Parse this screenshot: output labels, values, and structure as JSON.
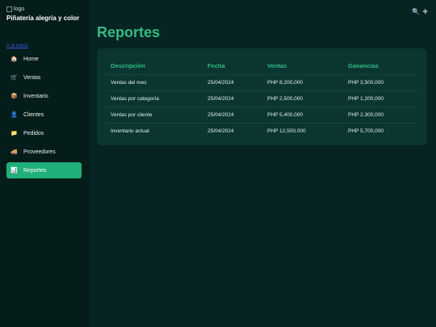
{
  "app": {
    "logo_alt": "logo",
    "brand": "Piñatería alegría y color",
    "menu_link": "Ir al menú"
  },
  "sidebar": {
    "items": [
      {
        "label": "Home",
        "icon": "🏠",
        "icon_name": "home-icon",
        "active": false
      },
      {
        "label": "Ventas",
        "icon": "🛒",
        "icon_name": "cart-icon",
        "active": false
      },
      {
        "label": "Inventario",
        "icon": "📦",
        "icon_name": "box-icon",
        "active": false
      },
      {
        "label": "Clientes",
        "icon": "👤",
        "icon_name": "user-icon",
        "active": false
      },
      {
        "label": "Pedidos",
        "icon": "📁",
        "icon_name": "folder-icon",
        "active": false
      },
      {
        "label": "Proveedores",
        "icon": "🚚",
        "icon_name": "truck-icon",
        "active": false
      },
      {
        "label": "Reportes",
        "icon": "📊",
        "icon_name": "chart-icon",
        "active": true
      }
    ]
  },
  "header": {
    "title": "Reportes",
    "icons": [
      {
        "glyph": "🔍",
        "name": "search-icon"
      },
      {
        "glyph": "✚",
        "name": "add-icon"
      }
    ]
  },
  "table": {
    "columns": [
      "Descripción",
      "Fecha",
      "Ventas",
      "Ganancias"
    ],
    "rows": [
      [
        "Ventas del mes",
        "25/04/2024",
        "PHP 8,200,000",
        "PHP 3,500,000"
      ],
      [
        "Ventas por categoría",
        "25/04/2024",
        "PHP 2,500,000",
        "PHP 1,200,000"
      ],
      [
        "Ventas por cliente",
        "25/04/2024",
        "PHP 5,400,000",
        "PHP 2,300,000"
      ],
      [
        "Inventario actual",
        "25/04/2024",
        "PHP 12,500,000",
        "PHP 5,700,000"
      ]
    ]
  },
  "colors": {
    "accent": "#2ebd85",
    "active_nav": "#1fb07a",
    "background": "#062421",
    "sidebar": "#041c1a",
    "card": "#0a3530"
  }
}
